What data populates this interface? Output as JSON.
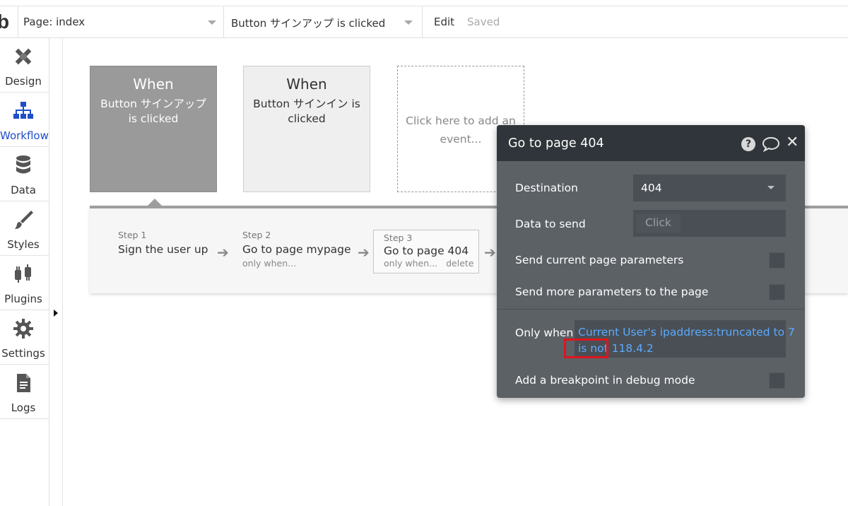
{
  "topbar": {
    "logo": "b",
    "page_select": "Page: index",
    "event_select": "Button サインアップ is clicked",
    "edit_label": "Edit",
    "status": "Saved"
  },
  "sidebar": {
    "items": [
      {
        "label": "Design",
        "icon": "design-icon"
      },
      {
        "label": "Workflow",
        "icon": "workflow-icon",
        "active": true
      },
      {
        "label": "Data",
        "icon": "data-icon"
      },
      {
        "label": "Styles",
        "icon": "styles-icon"
      },
      {
        "label": "Plugins",
        "icon": "plugins-icon"
      },
      {
        "label": "Settings",
        "icon": "settings-icon"
      },
      {
        "label": "Logs",
        "icon": "logs-icon"
      }
    ]
  },
  "events": [
    {
      "when": "When",
      "text": "Button サインアップ is clicked",
      "selected": true
    },
    {
      "when": "When",
      "text": "Button サインイン is clicked",
      "selected": false
    }
  ],
  "add_event_text": "Click here to add an event...",
  "steps": [
    {
      "number": "Step 1",
      "title": "Sign the user up"
    },
    {
      "number": "Step 2",
      "title": "Go to page mypage",
      "meta": "only when..."
    },
    {
      "number": "Step 3",
      "title": "Go to page 404",
      "meta": "only when...",
      "delete": "delete"
    }
  ],
  "panel": {
    "title": "Go to page 404",
    "destination_label": "Destination",
    "destination_value": "404",
    "data_to_send_label": "Data to send",
    "data_to_send_placeholder": "Click",
    "send_current_params_label": "Send current page parameters",
    "send_more_params_label": "Send more parameters to the page",
    "only_when_label": "Only when",
    "condition_line1": "Current User's ipaddress:truncated to 7",
    "condition_line2": "is not 118.4.2",
    "breakpoint_label": "Add a breakpoint in debug mode"
  },
  "colors": {
    "accent_blue": "#1f4ec9",
    "condition_blue": "#5aabff",
    "panel_bg": "#5c6166",
    "panel_header_bg": "#2f353a",
    "highlight_red": "#e0141c"
  }
}
